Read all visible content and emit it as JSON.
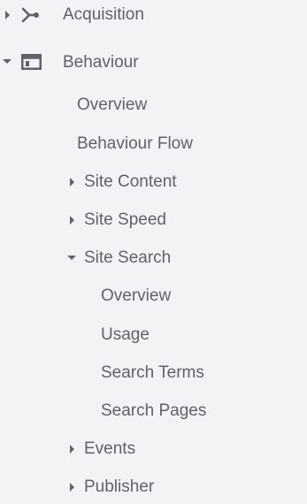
{
  "nav": {
    "acquisition": {
      "label": "Acquisition",
      "icon": "acquisition-icon",
      "expanded": false
    },
    "behaviour": {
      "label": "Behaviour",
      "icon": "behaviour-icon",
      "expanded": true,
      "items": {
        "overview": "Overview",
        "behaviour_flow": "Behaviour Flow",
        "site_content": "Site Content",
        "site_speed": "Site Speed",
        "site_search": {
          "label": "Site Search",
          "expanded": true,
          "items": {
            "overview": "Overview",
            "usage": "Usage",
            "search_terms": "Search Terms",
            "search_pages": "Search Pages"
          }
        },
        "events": "Events",
        "publisher": "Publisher"
      }
    }
  },
  "colors": {
    "background": "#f1f3f4",
    "text": "#5f6368"
  }
}
